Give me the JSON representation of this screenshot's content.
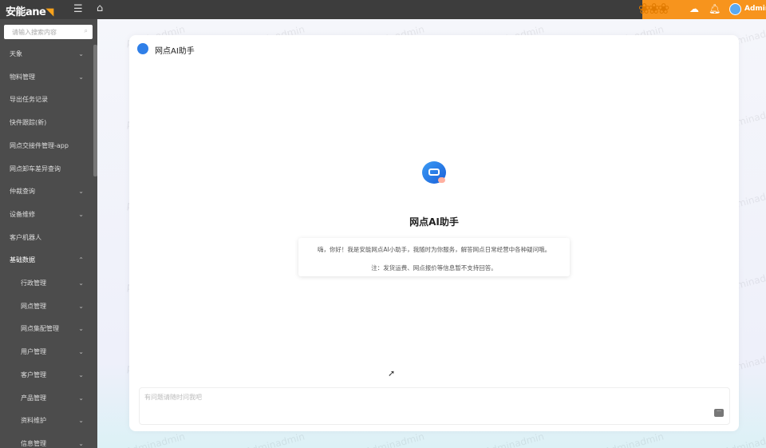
{
  "topbar": {
    "logo": "安能ane",
    "user": "Admin"
  },
  "sidebar": {
    "search_placeholder": "请输入搜索内容",
    "items": [
      {
        "label": "天象",
        "chevron": "down"
      },
      {
        "label": "物料管理",
        "chevron": "down"
      },
      {
        "label": "导出任务记录"
      },
      {
        "label": "快件跟踪(新)"
      },
      {
        "label": "网点交接件管理-app"
      },
      {
        "label": "网点卸车差异查询"
      },
      {
        "label": "仲裁查询",
        "chevron": "down"
      },
      {
        "label": "设备维修",
        "chevron": "down"
      },
      {
        "label": "客户机器人"
      },
      {
        "label": "基础数据",
        "chevron": "up"
      }
    ],
    "children": [
      {
        "label": "行政管理"
      },
      {
        "label": "网点管理"
      },
      {
        "label": "网点集配管理"
      },
      {
        "label": "用户管理"
      },
      {
        "label": "客户管理"
      },
      {
        "label": "产品管理"
      },
      {
        "label": "资料维护"
      },
      {
        "label": "信息管理"
      }
    ]
  },
  "main": {
    "header_title": "网点AI助手",
    "bot_title": "网点AI助手",
    "welcome_line1": "嗨，你好！我是安能网点AI小助手，我随时为你服务，解答网点日常经营中各种疑问哦。",
    "welcome_line2": "注：发货运费、网点报价等信息暂不支持回答。",
    "input_placeholder": "有问题请随时问我吧"
  },
  "watermark": "Adminadmin"
}
